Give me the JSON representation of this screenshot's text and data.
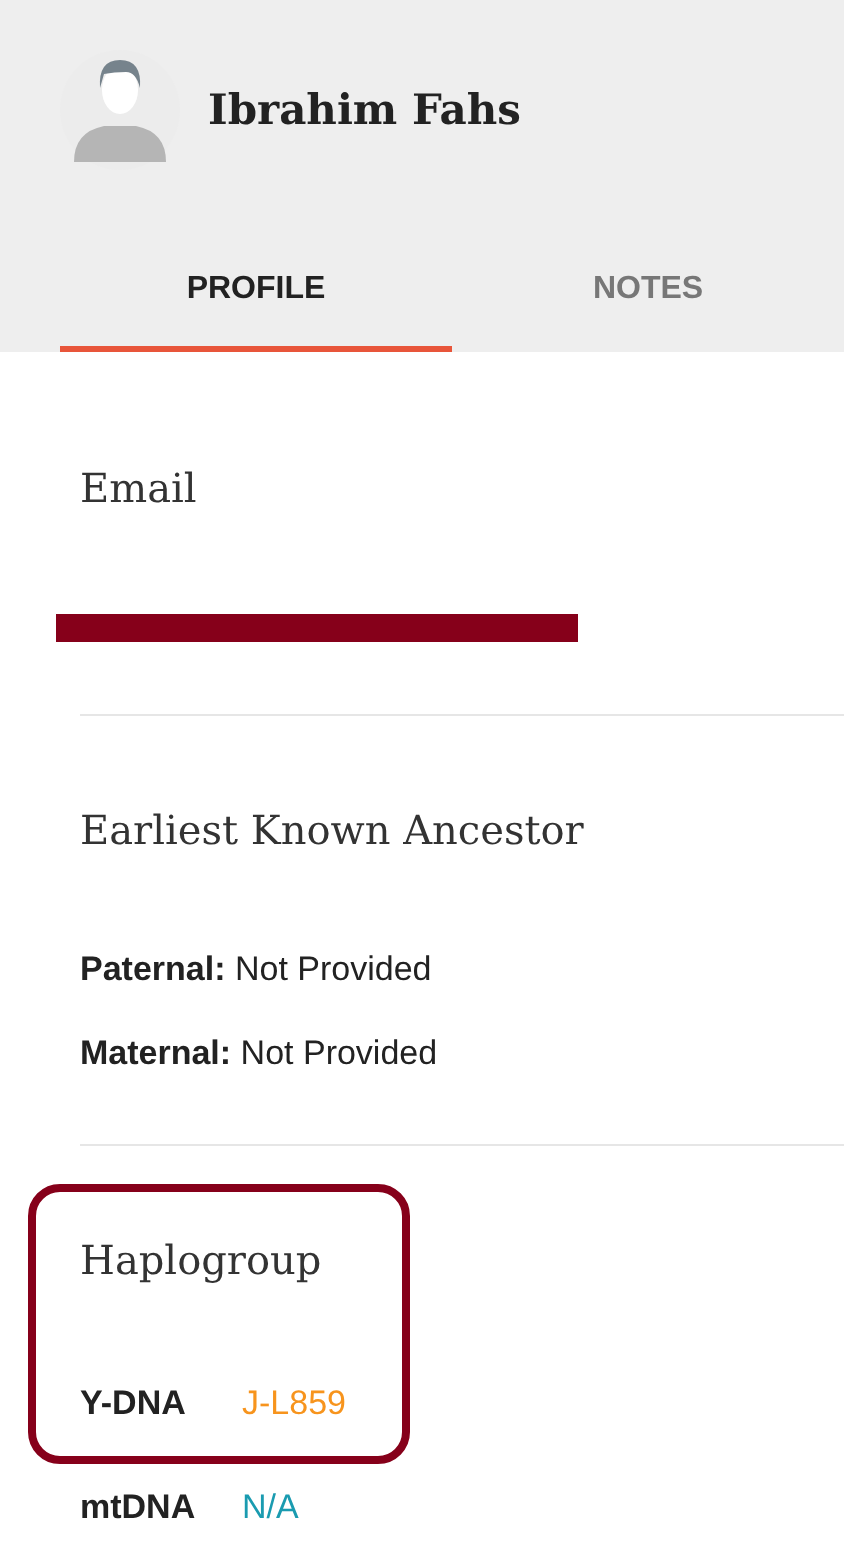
{
  "profile": {
    "name": "Ibrahim Fahs"
  },
  "tabs": [
    {
      "label": "PROFILE",
      "selected": true
    },
    {
      "label": "NOTES",
      "selected": false
    }
  ],
  "email": {
    "title": "Email",
    "redacted": true
  },
  "ancestor": {
    "title": "Earliest Known Ancestor",
    "lines": [
      {
        "label": "Paternal:",
        "value": "Not Provided"
      },
      {
        "label": "Maternal:",
        "value": "Not Provided"
      }
    ]
  },
  "haplogroup": {
    "title": "Haplogroup",
    "highlighted": true,
    "items": [
      {
        "label": "Y-DNA",
        "value": "J-L859",
        "color": "#f7941d"
      },
      {
        "label": "mtDNA",
        "value": "N/A",
        "color": "#1a9bb0"
      }
    ]
  }
}
